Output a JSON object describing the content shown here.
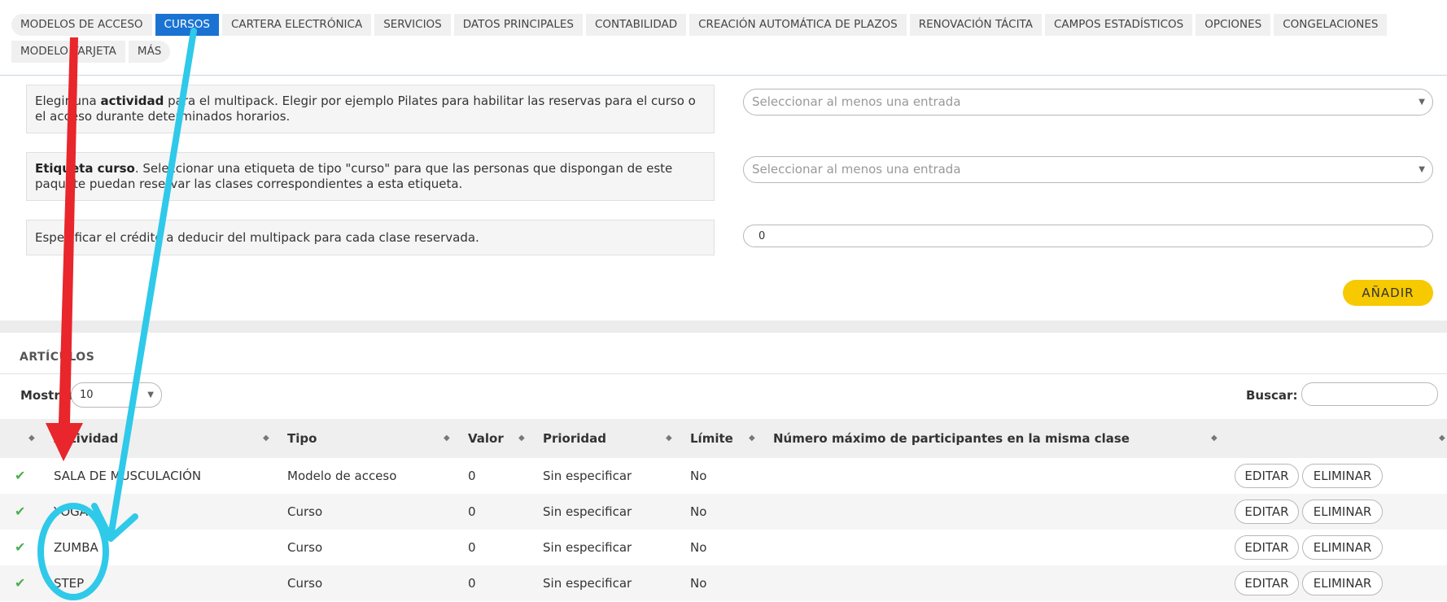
{
  "tabs": [
    {
      "label": "MODELOS DE ACCESO",
      "active": false
    },
    {
      "label": "CURSOS",
      "active": true
    },
    {
      "label": "CARTERA ELECTRÓNICA",
      "active": false
    },
    {
      "label": "SERVICIOS",
      "active": false
    },
    {
      "label": "DATOS PRINCIPALES",
      "active": false
    },
    {
      "label": "CONTABILIDAD",
      "active": false
    },
    {
      "label": "CREACIÓN AUTOMÁTICA DE PLAZOS",
      "active": false
    },
    {
      "label": "RENOVACIÓN TÁCITA",
      "active": false
    },
    {
      "label": "CAMPOS ESTADÍSTICOS",
      "active": false
    },
    {
      "label": "OPCIONES",
      "active": false
    },
    {
      "label": "CONGELACIONES",
      "active": false
    },
    {
      "label": "MODELO TARJETA",
      "active": false
    },
    {
      "label": "MÁS",
      "active": false
    }
  ],
  "form": {
    "activity_desc_pre": "Elegir una ",
    "activity_desc_bold": "actividad",
    "activity_desc_post": " para el multipack. Elegir por ejemplo Pilates para habilitar las reservas para el curso o el acceso durante determinados horarios.",
    "activity_placeholder": "Seleccionar al menos una entrada",
    "label_desc_bold": "Etiqueta curso",
    "label_desc_post": ". Seleccionar una etiqueta de tipo \"curso\" para que las personas que dispongan de este paquete puedan reservar las clases correspondientes a esta etiqueta.",
    "label_placeholder": "Seleccionar al menos una entrada",
    "credit_desc": "Especificar el crédito a deducir del multipack para cada clase reservada.",
    "credit_value": "0",
    "add_label": "AÑADIR"
  },
  "list": {
    "title": "ARTÍCULOS",
    "show_label": "Mostrar",
    "show_value": "10",
    "search_label": "Buscar:",
    "columns": [
      "Actividad",
      "Tipo",
      "Valor",
      "Prioridad",
      "Límite",
      "Número máximo de participantes en la misma clase"
    ],
    "edit_label": "EDITAR",
    "delete_label": "ELIMINAR",
    "rows": [
      {
        "actividad": "SALA DE MUSCULACIÓN",
        "tipo": "Modelo de acceso",
        "valor": "0",
        "prioridad": "Sin especificar",
        "limite": "No",
        "max": ""
      },
      {
        "actividad": "YOGA",
        "tipo": "Curso",
        "valor": "0",
        "prioridad": "Sin especificar",
        "limite": "No",
        "max": ""
      },
      {
        "actividad": "ZUMBA",
        "tipo": "Curso",
        "valor": "0",
        "prioridad": "Sin especificar",
        "limite": "No",
        "max": ""
      },
      {
        "actividad": "STEP",
        "tipo": "Curso",
        "valor": "0",
        "prioridad": "Sin especificar",
        "limite": "No",
        "max": ""
      }
    ]
  },
  "icons": {
    "check": "check-icon",
    "sort": "sort-icon",
    "caret": "chevron-down-icon"
  },
  "colors": {
    "active_tab": "#1a73d2",
    "add_button": "#f6c900",
    "check": "#4caf50",
    "annotation_red": "#e8262b",
    "annotation_cyan": "#2fc9e9"
  }
}
